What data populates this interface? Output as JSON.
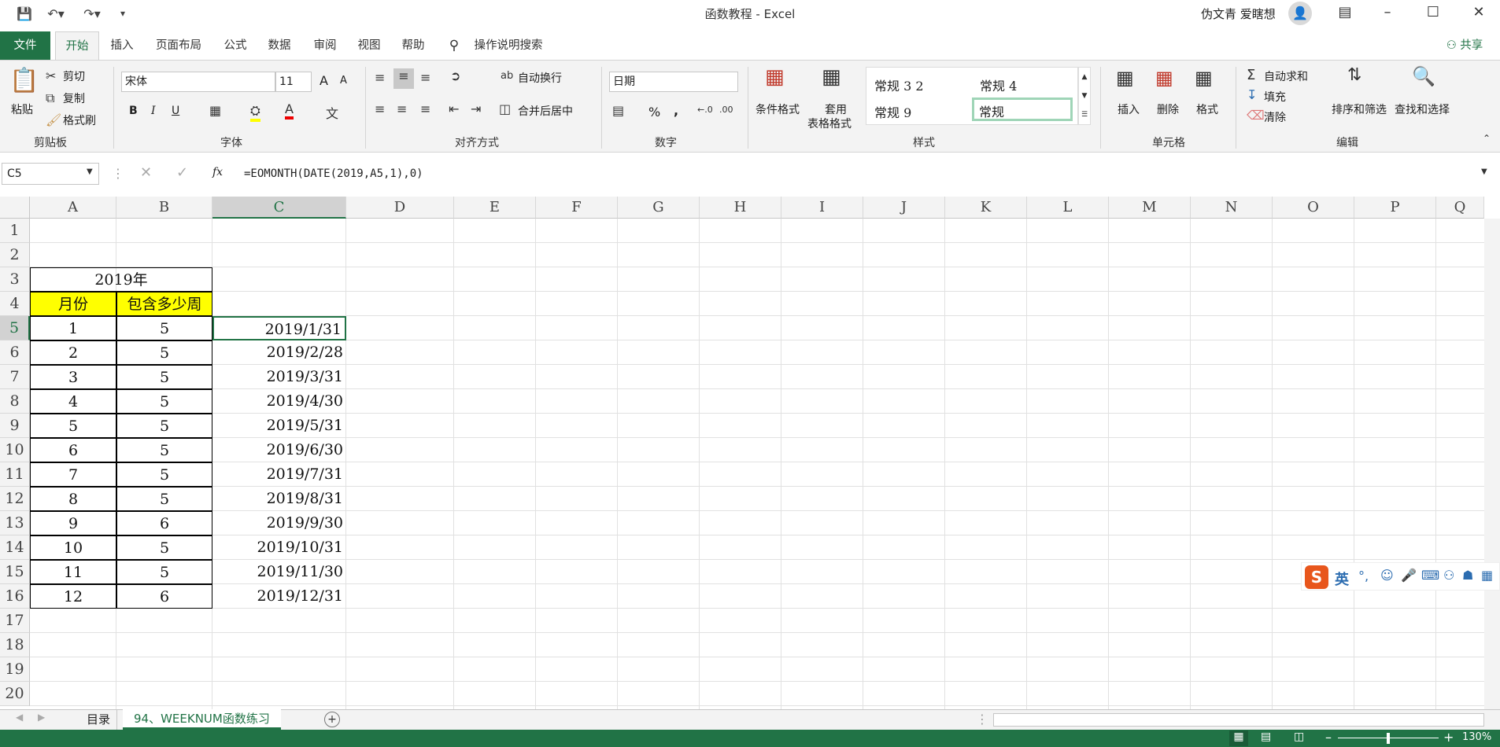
{
  "window": {
    "title": "函数教程  -  Excel",
    "user": "伪文青 爱瞎想"
  },
  "tabs": {
    "file": "文件",
    "items": [
      "开始",
      "插入",
      "页面布局",
      "公式",
      "数据",
      "审阅",
      "视图",
      "帮助"
    ],
    "tell_me": "操作说明搜索",
    "share": "共享"
  },
  "ribbon": {
    "clipboard": {
      "paste": "粘贴",
      "cut": "剪切",
      "copy": "复制",
      "painter": "格式刷",
      "label": "剪贴板"
    },
    "font": {
      "name": "宋体",
      "size": "11",
      "grow": "A",
      "shrink": "A",
      "bold": "B",
      "italic": "I",
      "underline": "U",
      "label": "字体"
    },
    "alignment": {
      "wrap": "自动换行",
      "merge": "合并后居中",
      "label": "对齐方式"
    },
    "number": {
      "format": "日期",
      "percent": "%",
      "comma": ",",
      "label": "数字"
    },
    "styles": {
      "conditional": "条件格式",
      "table_line1": "套用",
      "table_line2": "表格格式",
      "gallery": [
        "常规 3 2",
        "常规 4",
        "常规 9",
        "常规"
      ],
      "label": "样式"
    },
    "cells": {
      "insert": "插入",
      "delete": "删除",
      "format": "格式",
      "label": "单元格"
    },
    "editing": {
      "autosum": "自动求和",
      "fill": "填充",
      "clear": "清除",
      "sort": "排序和筛选",
      "find": "查找和选择",
      "label": "编辑"
    }
  },
  "formula_bar": {
    "name_box": "C5",
    "fx": "fx",
    "formula": "=EOMONTH(DATE(2019,A5,1),0)"
  },
  "grid": {
    "columns": [
      "A",
      "B",
      "C",
      "D",
      "E",
      "F",
      "G",
      "H",
      "I",
      "J",
      "K",
      "L",
      "M",
      "N",
      "O",
      "P",
      "Q"
    ],
    "rows": [
      "1",
      "2",
      "3",
      "4",
      "5",
      "6",
      "7",
      "8",
      "9",
      "10",
      "11",
      "12",
      "13",
      "14",
      "15",
      "16",
      "17",
      "18",
      "19",
      "20"
    ],
    "table_title": "2019年",
    "header_month": "月份",
    "header_weeks": "包含多少周",
    "month": [
      "1",
      "2",
      "3",
      "4",
      "5",
      "6",
      "7",
      "8",
      "9",
      "10",
      "11",
      "12"
    ],
    "weeks": [
      "5",
      "5",
      "5",
      "5",
      "5",
      "5",
      "5",
      "5",
      "6",
      "5",
      "5",
      "6"
    ],
    "eom": [
      "2019/1/31",
      "2019/2/28",
      "2019/3/31",
      "2019/4/30",
      "2019/5/31",
      "2019/6/30",
      "2019/7/31",
      "2019/8/31",
      "2019/9/30",
      "2019/10/31",
      "2019/11/30",
      "2019/12/31"
    ],
    "header_fill": "#ffff00"
  },
  "sheets": {
    "items": [
      "目录",
      "94、WEEKNUM函数练习"
    ],
    "active": 1
  },
  "status": {
    "zoom": "130%"
  },
  "ime": {
    "mode": "英"
  },
  "colors": {
    "brand": "#217346"
  }
}
